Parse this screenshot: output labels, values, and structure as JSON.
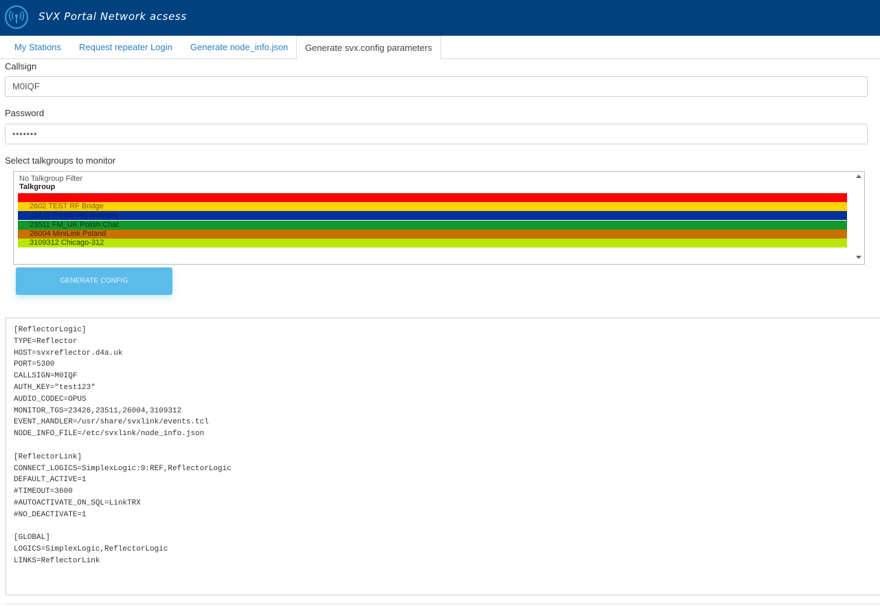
{
  "app": {
    "title": "SVX Portal Network acsess",
    "logo_icon": "radio-tower-icon",
    "header_color": "#00417f"
  },
  "tabs": [
    {
      "label": "My Stations",
      "active": false
    },
    {
      "label": "Request repeater Login",
      "active": false
    },
    {
      "label": "Generate node_info.json",
      "active": false
    },
    {
      "label": "Generate svx.config parameters",
      "active": true
    }
  ],
  "form": {
    "callsign_label": "Callsign",
    "callsign_value": "M0IQF",
    "password_label": "Password",
    "password_value": "•••••••",
    "talkgroups_label": "Select talkgroups to monitor",
    "no_filter_option": "No Talkgroup Filter",
    "group_label": "Talkgroup",
    "talkgroups": [
      {
        "label": "999 TEST TG",
        "color": "#ff0000",
        "text_color": "#d01010"
      },
      {
        "label": "2602 TEST RF Bridge",
        "color": "#ffd200",
        "text_color": "#7a6200"
      },
      {
        "label": "23426 FreeSTAR Network",
        "color": "#00309c",
        "text_color": "#0a1f66"
      },
      {
        "label": "23511 FM_UK Polish Chat",
        "color": "#10982a",
        "text_color": "#0a3a12"
      },
      {
        "label": "26004 MiniLink Poland",
        "color": "#c87000",
        "text_color": "#3d2200"
      },
      {
        "label": "3109312 Chicago-312",
        "color": "#b8e600",
        "text_color": "#2b3a00"
      }
    ],
    "generate_button": "GENERATE CONFIG"
  },
  "config_output": "[ReflectorLogic]\nTYPE=Reflector\nHOST=svxreflector.d4a.uk\nPORT=5300\nCALLSIGN=M0IQF\nAUTH_KEY=\"test123\"\nAUDIO_CODEC=OPUS\nMONITOR_TGS=23426,23511,26004,3109312\nEVENT_HANDLER=/usr/share/svxlink/events.tcl\nNODE_INFO_FILE=/etc/svxlink/node_info.json\n\n[ReflectorLink]\nCONNECT_LOGICS=SimplexLogic:9:REF,ReflectorLogic\nDEFAULT_ACTIVE=1\n#TIMEOUT=3600\n#AUTOACTIVATE_ON_SQL=LinkTRX\n#NO_DEACTIVATE=1\n\n[GLOBAL]\nLOGICS=SimplexLogic,ReflectorLogic\nLINKS=ReflectorLink"
}
